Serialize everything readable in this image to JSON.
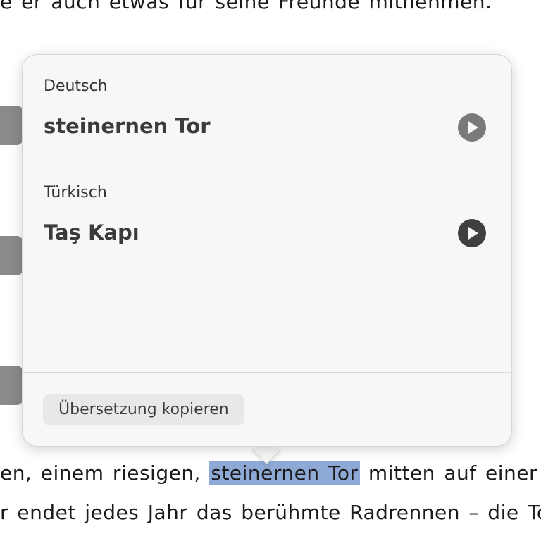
{
  "document": {
    "top_line": "e er auch etwas für seine Freunde mitnehmen.",
    "line1_before": "en, einem riesigen, ",
    "line1_highlight": "steinernen Tor",
    "line1_after": " mitten auf einer ries",
    "line2": "r endet jedes Jahr das berühmte Radrennen – die Tou"
  },
  "popover": {
    "source_language": "Deutsch",
    "source_text": "steinernen Tor",
    "target_language": "Türkisch",
    "target_text": "Taş Kapı",
    "copy_button": "Übersetzung kopieren"
  },
  "colors": {
    "highlight": "#8fa9d6",
    "play_source": "#7a7a7a",
    "play_target": "#3f3f3f"
  },
  "icons": {
    "play": "play-icon"
  }
}
